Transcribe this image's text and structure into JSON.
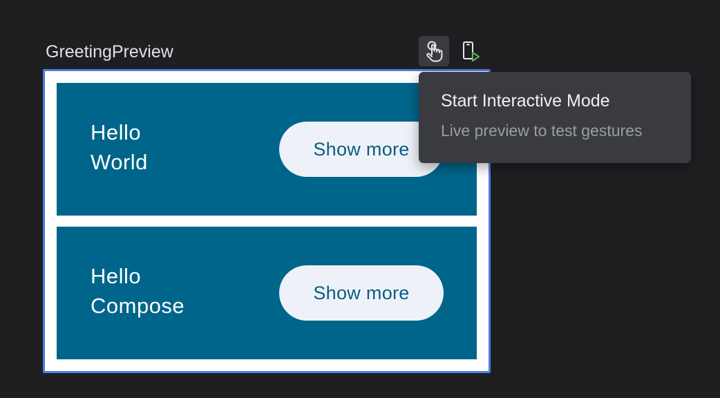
{
  "preview": {
    "title": "GreetingPreview"
  },
  "toolbar": {
    "interactive_icon": "touch-hand-icon",
    "run_icon": "run-on-device-icon",
    "run_accent_color": "#5fb85a"
  },
  "cards": [
    {
      "greeting_line1": "Hello",
      "greeting_line2": "World",
      "button_label": "Show more"
    },
    {
      "greeting_line1": "Hello",
      "greeting_line2": "Compose",
      "button_label": "Show more"
    }
  ],
  "colors": {
    "card_background": "#00658a",
    "button_background": "#eef2f8",
    "selection_border": "#4f7de0"
  },
  "tooltip": {
    "title": "Start Interactive Mode",
    "subtitle": "Live preview to test gestures"
  }
}
